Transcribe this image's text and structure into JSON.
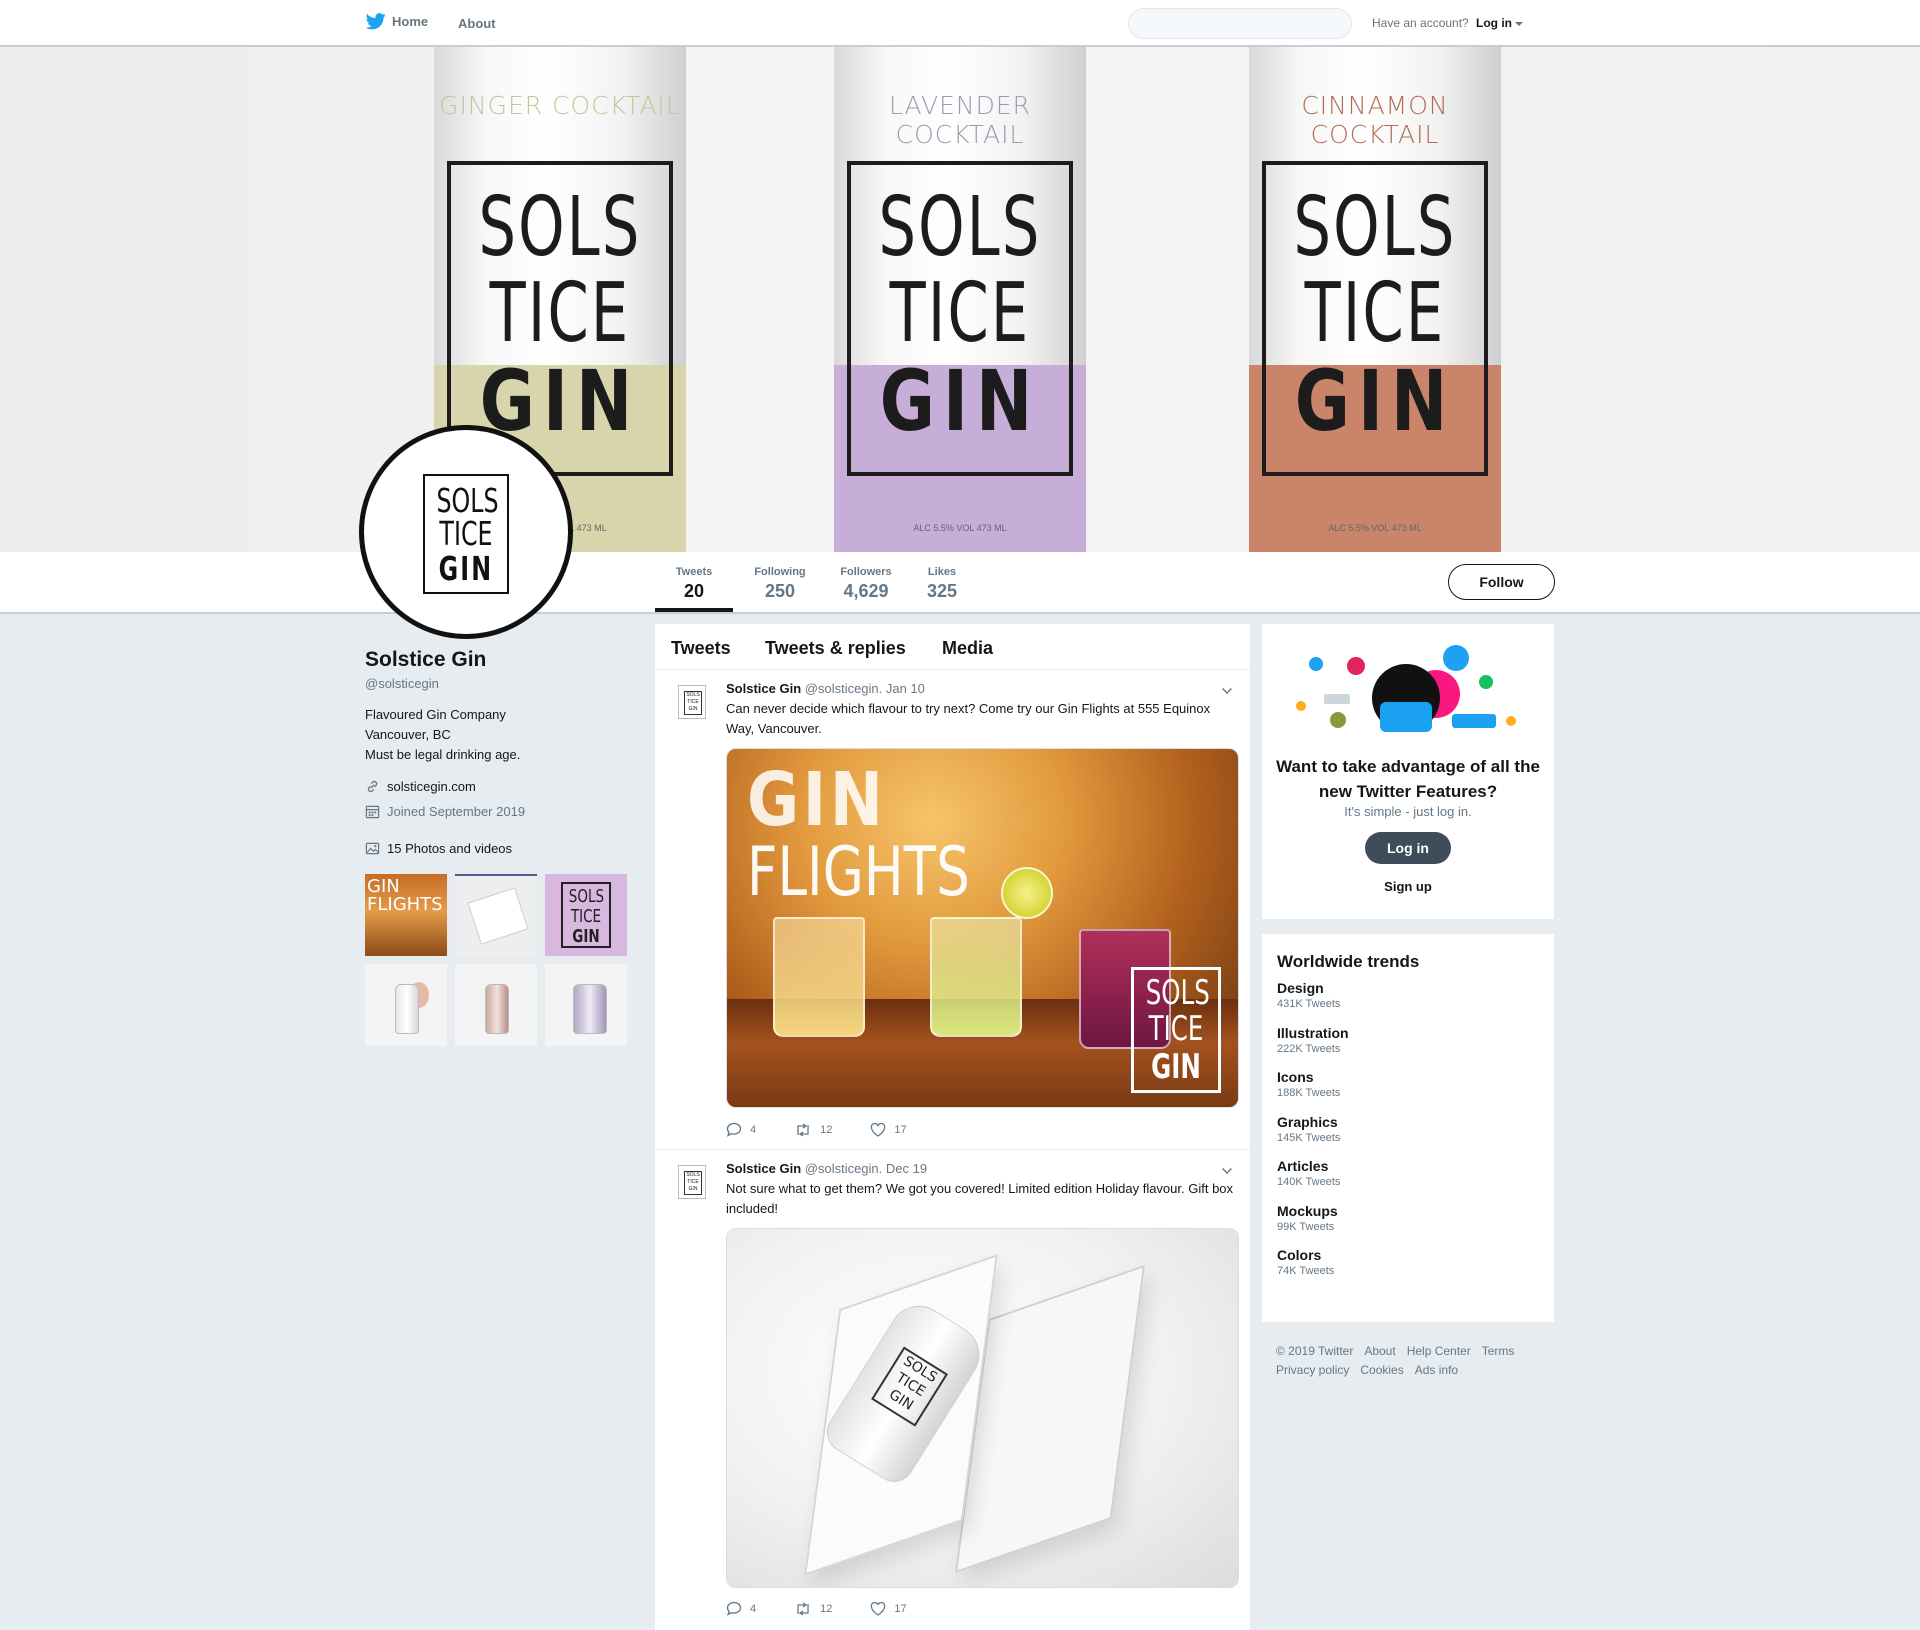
{
  "nav": {
    "home_label": "Home",
    "about_label": "About",
    "search_placeholder": "",
    "account_prompt": "Have an account?",
    "login_label": "Log in"
  },
  "banner": {
    "cans": [
      {
        "flavor": "GINGER COCKTAIL",
        "line1": "SOLS",
        "line2": "TICE",
        "line3": "GIN",
        "volume": "ALC 5.5%  VOL 473 ML",
        "band_color": "#d8d4ab",
        "flavor_color": "#c9c39a"
      },
      {
        "flavor": "LAVENDER COCKTAIL",
        "line1": "SOLS",
        "line2": "TICE",
        "line3": "GIN",
        "volume": "ALC 5.5%  VOL 473 ML",
        "band_color": "#c7aed8",
        "flavor_color": "#a596b2"
      },
      {
        "flavor": "CINNAMON COCKTAIL",
        "line1": "SOLS",
        "line2": "TICE",
        "line3": "GIN",
        "volume": "ALC 5.5%  VOL 473 ML",
        "band_color": "#c98469",
        "flavor_color": "#b36c52"
      }
    ]
  },
  "avatar": {
    "line1": "SOLS",
    "line2": "TICE",
    "line3": "GIN"
  },
  "stats": [
    {
      "label": "Tweets",
      "value": "20"
    },
    {
      "label": "Following",
      "value": "250"
    },
    {
      "label": "Followers",
      "value": "4,629"
    },
    {
      "label": "Likes",
      "value": "325"
    }
  ],
  "follow_label": "Follow",
  "profile": {
    "name": "Solstice Gin",
    "handle": "@solsticegin",
    "bio_line1": "Flavoured Gin Company",
    "bio_line2": "Vancouver, BC",
    "bio_line3": "Must be legal drinking age.",
    "website": "solsticegin.com",
    "joined": "Joined September 2019",
    "photos_label": "15 Photos and videos",
    "thumb1_text": "GIN\nFLIGHTS",
    "thumb3_line1": "SOLS",
    "thumb3_line2": "TICE",
    "thumb3_line3": "GIN"
  },
  "tabs": [
    "Tweets",
    "Tweets & replies",
    "Media"
  ],
  "tweets": [
    {
      "name": "Solstice Gin",
      "handle": "@solsticegin. Jan 10",
      "text": "Can never decide which flavour to try next? Come try our Gin Flights at 555 Equinox Way, Vancouver.",
      "media": {
        "title1": "GIN",
        "title2": "FLIGHTS",
        "logo1": "SOLS",
        "logo2": "TICE",
        "logo3": "GIN"
      },
      "replies": "4",
      "retweets": "12",
      "likes": "17"
    },
    {
      "name": "Solstice Gin",
      "handle": "@solsticegin. Dec 19",
      "text": "Not sure what to get them? We got you covered! Limited edition Holiday flavour. Gift box included!",
      "media": {
        "label": "SOLS TICE GIN"
      },
      "replies": "4",
      "retweets": "12",
      "likes": "17"
    }
  ],
  "promo": {
    "title": "Want to take advantage of all the new Twitter Features?",
    "subtitle": "It's simple - just log in.",
    "login_label": "Log in",
    "signup_label": "Sign up"
  },
  "trends": {
    "title": "Worldwide trends",
    "items": [
      {
        "name": "Design",
        "count": "431K Tweets"
      },
      {
        "name": "Illustration",
        "count": "222K Tweets"
      },
      {
        "name": "Icons",
        "count": "188K Tweets"
      },
      {
        "name": "Graphics",
        "count": "145K Tweets"
      },
      {
        "name": "Articles",
        "count": "140K Tweets"
      },
      {
        "name": "Mockups",
        "count": "99K Tweets"
      },
      {
        "name": "Colors",
        "count": "74K Tweets"
      }
    ]
  },
  "footer": {
    "copyright": "© 2019 Twitter",
    "about": "About",
    "help": "Help Center",
    "terms": "Terms",
    "privacy": "Privacy policy",
    "cookies": "Cookies",
    "ads": "Ads info"
  }
}
